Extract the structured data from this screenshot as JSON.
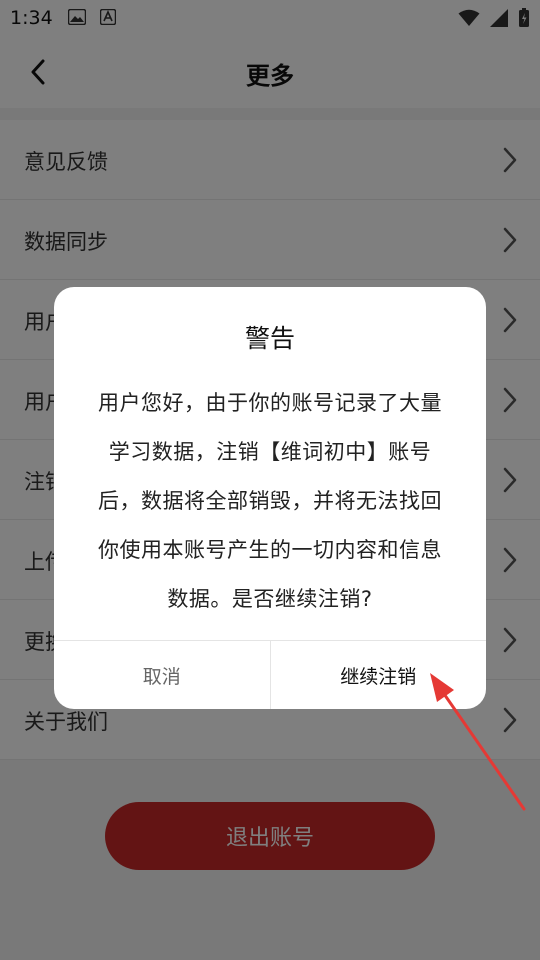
{
  "status_bar": {
    "time": "1:34",
    "left_icons": [
      "image-icon",
      "font-a-icon"
    ],
    "right_icons": [
      "wifi-icon",
      "signal-icon",
      "battery-charging-icon"
    ]
  },
  "nav": {
    "title": "更多",
    "back_icon": "chevron-left-icon"
  },
  "menu": {
    "items": [
      {
        "label": "意见反馈"
      },
      {
        "label": "数据同步"
      },
      {
        "label": "用户协议"
      },
      {
        "label": "用户隐私政策"
      },
      {
        "label": "注销账号"
      },
      {
        "label": "上传"
      },
      {
        "label": "更换"
      },
      {
        "label": "关于我们"
      }
    ]
  },
  "logout_button": {
    "label": "退出账号"
  },
  "dialog": {
    "title": "警告",
    "message_lines": [
      "用户您好，由于你的账号记录了大量",
      "学习数据，注销【维词初中】账号",
      "后，数据将全部销毁，并将无法找回",
      "你使用本账号产生的一切内容和信息",
      "数据。是否继续注销?"
    ],
    "cancel_label": "取消",
    "confirm_label": "继续注销"
  },
  "colors": {
    "accent": "#c62828",
    "overlay": "rgba(0,0,0,0.5)",
    "annotation_arrow": "#e53935"
  }
}
